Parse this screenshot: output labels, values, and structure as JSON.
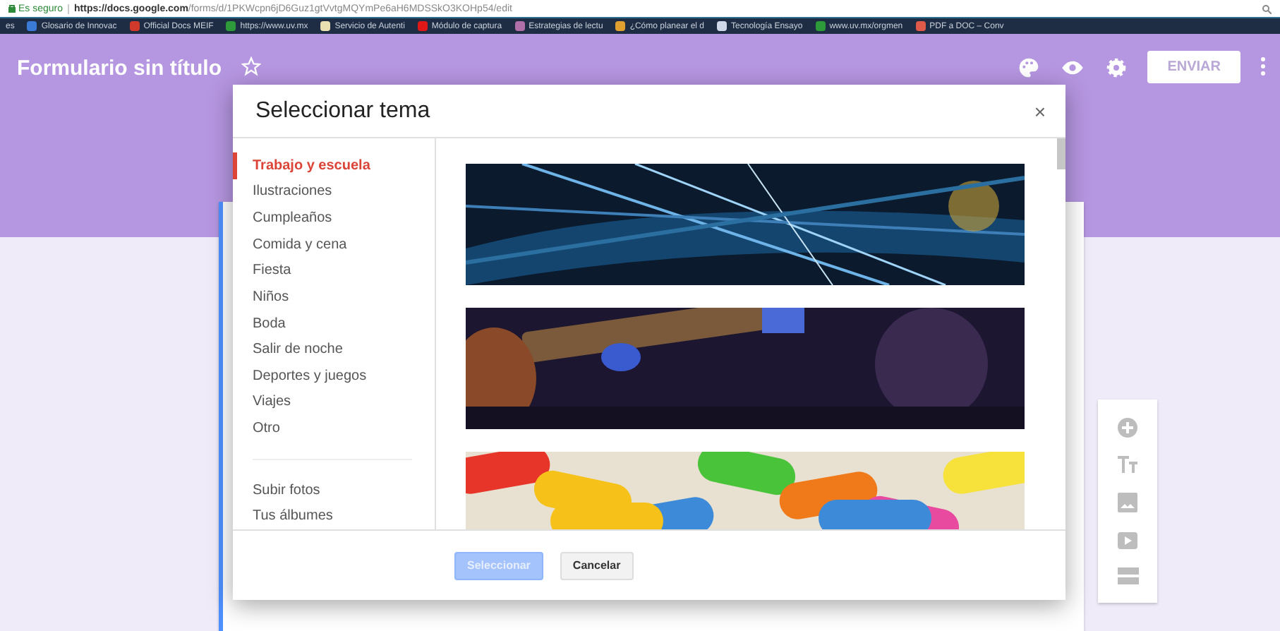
{
  "browser": {
    "security": "Es seguro",
    "url_host": "https://docs.google.com",
    "url_path": "/forms/d/1PKWcpn6jD6Guz1gtVvtgMQYmPe6aH6MDSSkO3KOHp54/edit",
    "bookmarks": [
      {
        "label": "es"
      },
      {
        "label": "Glosario de Innovac",
        "color": "#3b7bd8"
      },
      {
        "label": "Official Docs MEIF",
        "color": "#d03a2a"
      },
      {
        "label": "https://www.uv.mx",
        "color": "#2e9b3a"
      },
      {
        "label": "Servicio de Autenti",
        "color": "#e8e0b0"
      },
      {
        "label": "Módulo de captura",
        "color": "#e01818"
      },
      {
        "label": "Estrategias de lectu",
        "color": "#b06fa8"
      },
      {
        "label": "¿Cómo planear el d",
        "color": "#e0a030"
      },
      {
        "label": "Tecnología Ensayo",
        "color": "#cfd8e8"
      },
      {
        "label": "www.uv.mx/orgmen",
        "color": "#2e9b3a"
      },
      {
        "label": "PDF a DOC – Conv",
        "color": "#e05a4a"
      }
    ]
  },
  "form": {
    "title": "Formulario sin título",
    "send": "ENVIAR"
  },
  "dialog": {
    "title": "Seleccionar tema",
    "close": "×",
    "categories": [
      {
        "label": "Trabajo y escuela",
        "selected": true
      },
      {
        "label": "Ilustraciones",
        "selected": false
      },
      {
        "label": "Cumpleaños",
        "selected": false
      },
      {
        "label": "Comida y cena",
        "selected": false
      },
      {
        "label": "Fiesta",
        "selected": false
      },
      {
        "label": "Niños",
        "selected": false
      },
      {
        "label": "Boda",
        "selected": false
      },
      {
        "label": "Salir de noche",
        "selected": false
      },
      {
        "label": "Deportes y juegos",
        "selected": false
      },
      {
        "label": "Viajes",
        "selected": false
      },
      {
        "label": "Otro",
        "selected": false
      }
    ],
    "sources": [
      "Subir fotos",
      "Tus álbumes"
    ],
    "themes": [
      {
        "kind": "picture"
      },
      {
        "kind": "picture"
      },
      {
        "kind": "picture"
      }
    ],
    "buttons": [
      {
        "label": "Seleccionar",
        "kind": "primary",
        "disabled": true
      },
      {
        "label": "Cancelar",
        "kind": "secondary",
        "disabled": false
      }
    ]
  }
}
